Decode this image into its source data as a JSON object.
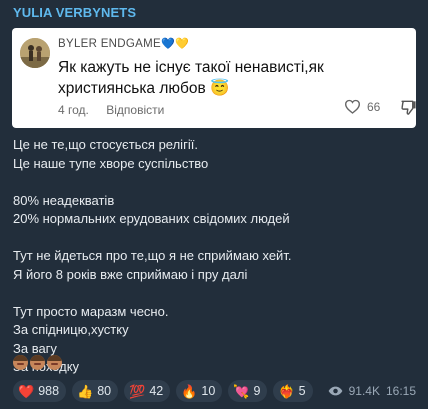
{
  "channel": {
    "author": "YULIA VERBYNETS"
  },
  "quote": {
    "author": "BYLER ENDGAME",
    "author_hearts": "💙💛",
    "text": "Як кажуть не існує такої ненависті,як християнська любов 😇",
    "time": "4 год.",
    "reply_label": "Відповісти",
    "likes": "66",
    "icons": [
      "heart-outline-icon",
      "thumbs-down-icon"
    ]
  },
  "body": {
    "paragraphs": [
      [
        "Це не те,що стосується релігії.",
        "Це наше тупе хворе суспільство"
      ],
      [
        "80% неадекватів",
        "20% нормальних ерудованих свідомих людей"
      ],
      [
        "Тут не йдеться про те,що я не сприймаю хейт.",
        "Я його 8 років вже сприймаю і пру далі"
      ],
      [
        "Тут просто маразм чесно.",
        "За спідницю,хустку",
        "За вагу",
        "За походку"
      ]
    ],
    "emoji_trailer": "🤦‍♀️🤦‍♀️🤦‍♀️"
  },
  "reactions": [
    {
      "emoji": "❤️",
      "count": "988"
    },
    {
      "emoji": "👍",
      "count": "80"
    },
    {
      "emoji": "💯",
      "count": "42"
    },
    {
      "emoji": "🔥",
      "count": "10"
    },
    {
      "emoji": "💘",
      "count": "9"
    },
    {
      "emoji": "❤️‍🔥",
      "count": "5"
    }
  ],
  "meta": {
    "views": "91.4K",
    "time": "16:15",
    "eye_icon": "eye-icon"
  }
}
